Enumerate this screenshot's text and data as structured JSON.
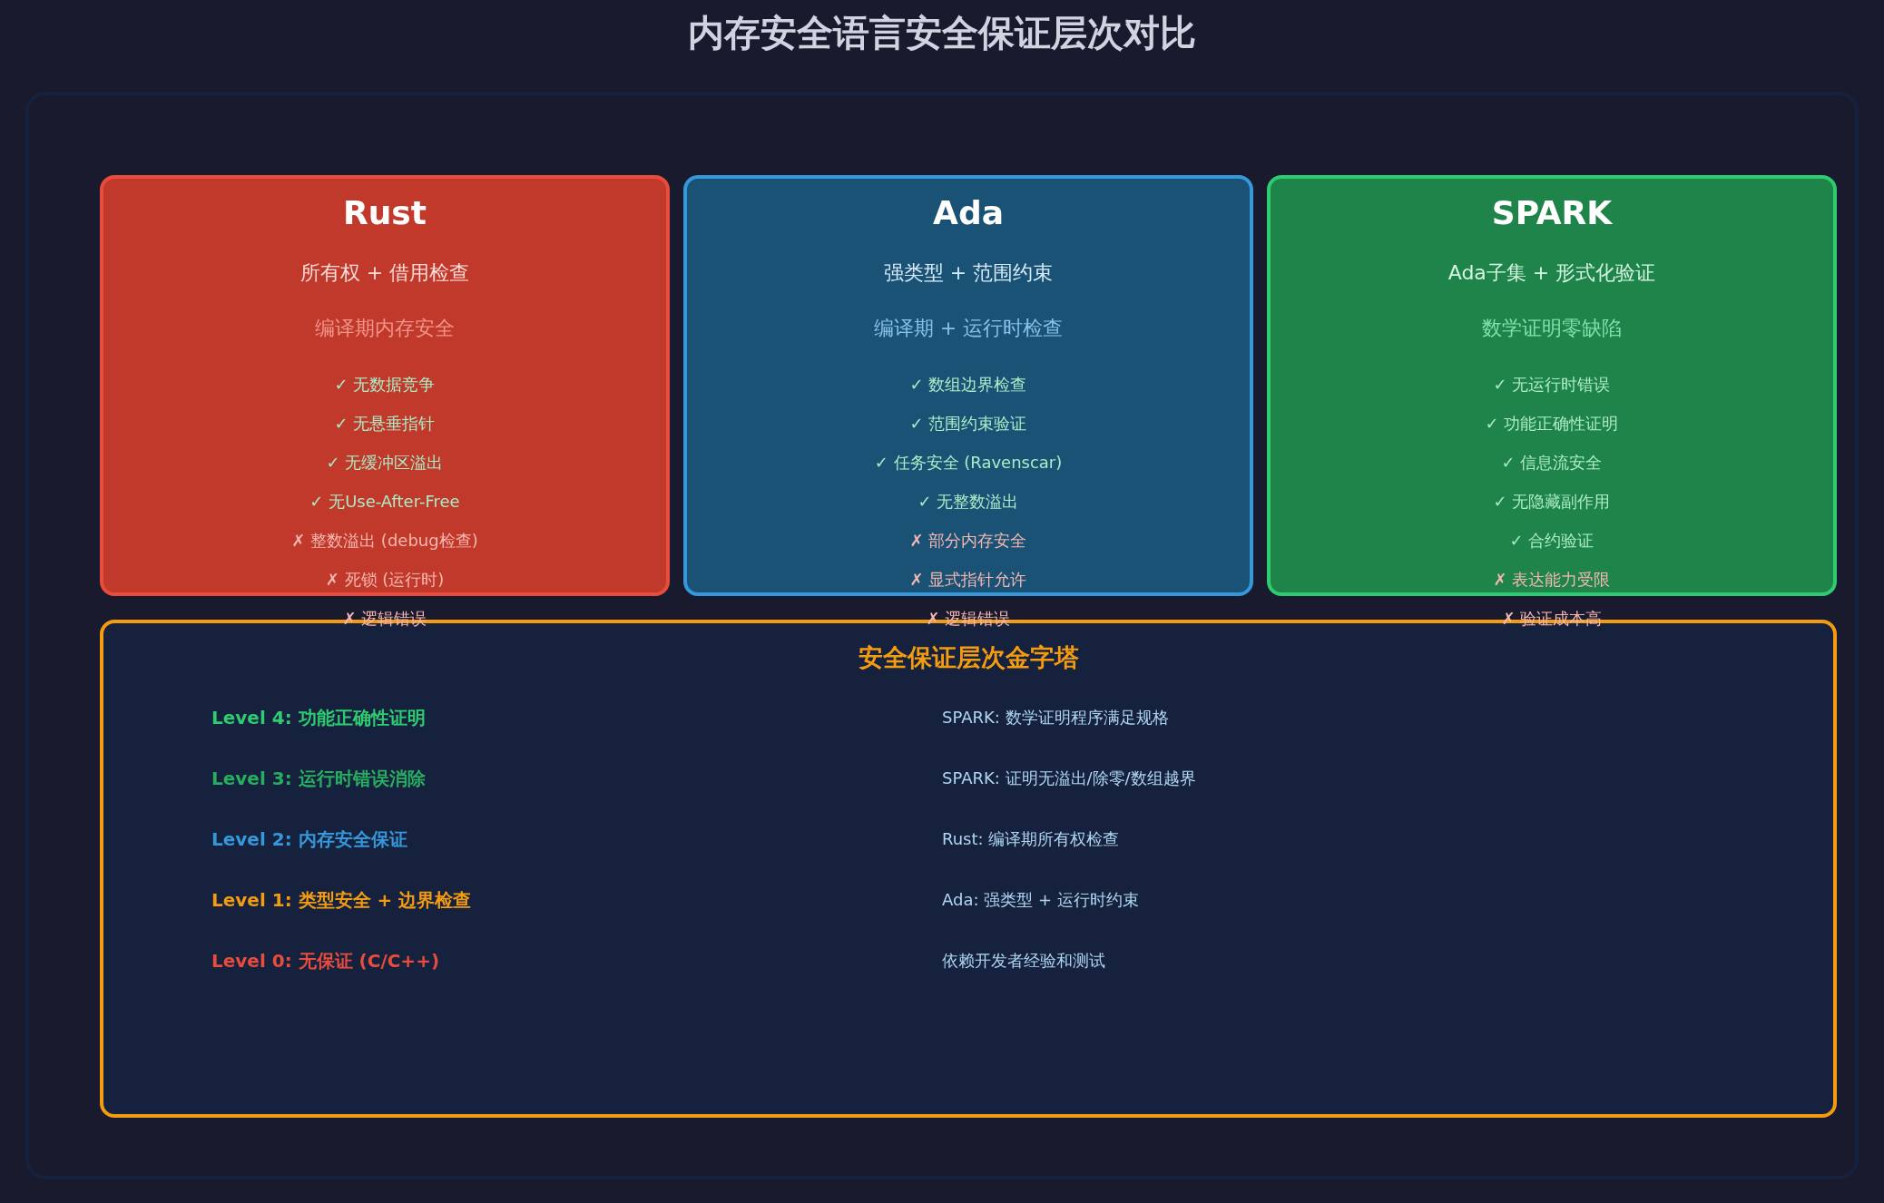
{
  "title": "内存安全语言安全保证层次对比",
  "languages": [
    {
      "name": "Rust",
      "color": "#e74c3c",
      "approach": "所有权 + 借用检查",
      "guarantee": "编译期内存安全",
      "features": [
        {
          "kind": "pro",
          "text": "✓ 无数据竞争"
        },
        {
          "kind": "pro",
          "text": "✓ 无悬垂指针"
        },
        {
          "kind": "pro",
          "text": "✓ 无缓冲区溢出"
        },
        {
          "kind": "pro",
          "text": "✓ 无Use-After-Free"
        },
        {
          "kind": "con",
          "text": "✗ 整数溢出 (debug检查)"
        },
        {
          "kind": "con",
          "text": "✗ 死锁 (运行时)"
        },
        {
          "kind": "con",
          "text": "✗ 逻辑错误"
        }
      ]
    },
    {
      "name": "Ada",
      "color": "#3498db",
      "approach": "强类型 + 范围约束",
      "guarantee": "编译期 + 运行时检查",
      "features": [
        {
          "kind": "pro",
          "text": "✓ 数组边界检查"
        },
        {
          "kind": "pro",
          "text": "✓ 范围约束验证"
        },
        {
          "kind": "pro",
          "text": "✓ 任务安全 (Ravenscar)"
        },
        {
          "kind": "pro",
          "text": "✓ 无整数溢出"
        },
        {
          "kind": "con",
          "text": "✗ 部分内存安全"
        },
        {
          "kind": "con",
          "text": "✗ 显式指针允许"
        },
        {
          "kind": "con",
          "text": "✗ 逻辑错误"
        }
      ]
    },
    {
      "name": "SPARK",
      "color": "#2ecc71",
      "approach": "Ada子集 + 形式化验证",
      "guarantee": "数学证明零缺陷",
      "features": [
        {
          "kind": "pro",
          "text": "✓ 无运行时错误"
        },
        {
          "kind": "pro",
          "text": "✓ 功能正确性证明"
        },
        {
          "kind": "pro",
          "text": "✓ 信息流安全"
        },
        {
          "kind": "pro",
          "text": "✓ 无隐藏副作用"
        },
        {
          "kind": "pro",
          "text": "✓ 合约验证"
        },
        {
          "kind": "con",
          "text": "✗ 表达能力受限"
        },
        {
          "kind": "con",
          "text": "✗ 验证成本高"
        }
      ]
    }
  ],
  "pyramid": {
    "title": "安全保证层次金字塔",
    "levels": [
      {
        "label": "Level 4: 功能正确性证明",
        "color": "#2ecc71",
        "description": "SPARK: 数学证明程序满足规格"
      },
      {
        "label": "Level 3: 运行时错误消除",
        "color": "#27ae60",
        "description": "SPARK: 证明无溢出/除零/数组越界"
      },
      {
        "label": "Level 2: 内存安全保证",
        "color": "#3498db",
        "description": "Rust: 编译期所有权检查"
      },
      {
        "label": "Level 1: 类型安全 + 边界检查",
        "color": "#f39c12",
        "description": "Ada: 强类型 + 运行时约束"
      },
      {
        "label": "Level 0: 无保证 (C/C++)",
        "color": "#e74c3c",
        "description": "依赖开发者经验和测试"
      }
    ]
  }
}
